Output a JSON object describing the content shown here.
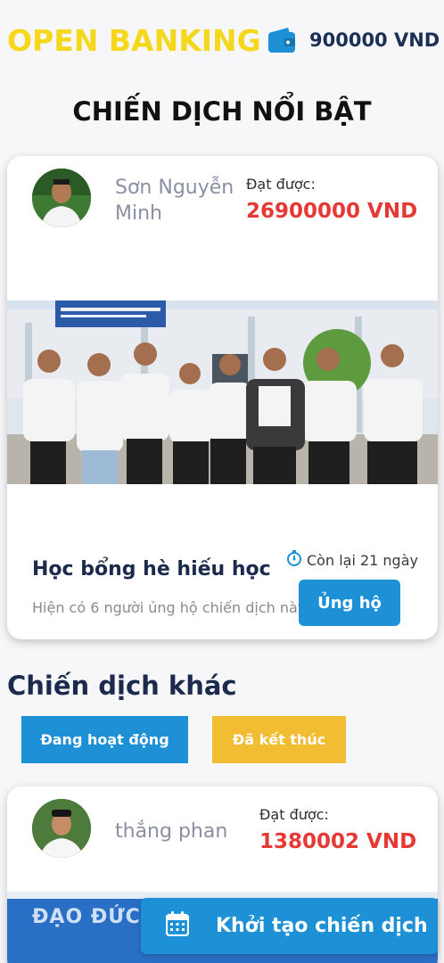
{
  "header": {
    "brand": "OPEN BANKING",
    "wallet_icon": "wallet-icon",
    "balance": "900000 VND"
  },
  "featured": {
    "section_title": "CHIẾN DỊCH NỔI BẬT",
    "owner_name": "Sơn Nguyễn Minh",
    "raised_label": "Đạt được:",
    "raised_amount": "26900000 VND",
    "title": "Học bổng hè hiếu học",
    "supporters_text": "Hiện có 6 người ủng hộ chiến dịch này",
    "remaining": "Còn lại 21 ngày",
    "timer_icon": "stopwatch-icon",
    "donate_label": "Ủng hộ"
  },
  "others": {
    "section_title": "Chiến dịch khác",
    "tabs": [
      "Đang hoạt động",
      "Đã kết thúc"
    ],
    "first_card": {
      "owner_name": "thắng phan",
      "raised_label": "Đạt được:",
      "raised_amount": "1380002 VND",
      "banner_text": "ĐẠO ĐỨC"
    }
  },
  "fab": {
    "label": "Khởi tạo chiến dịch",
    "icon": "calendar-icon"
  },
  "colors": {
    "brand_yellow": "#f5d71c",
    "primary_blue": "#1e90d6",
    "amount_red": "#e53935",
    "ended_tab": "#f2bd33",
    "navy_text": "#1b2a4d"
  }
}
